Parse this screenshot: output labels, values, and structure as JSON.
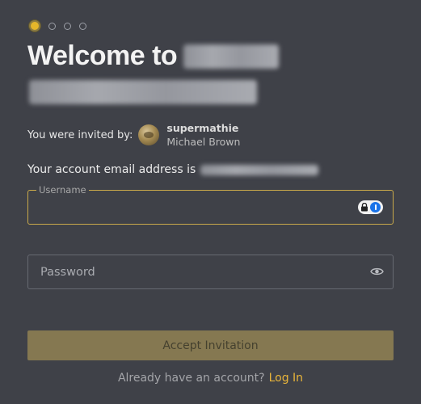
{
  "steps": {
    "total": 4,
    "current": 1
  },
  "header": {
    "welcome_text": "Welcome to"
  },
  "invite": {
    "label": "You were invited by:",
    "inviter_username": "supermathie",
    "inviter_fullname": "Michael Brown"
  },
  "account": {
    "email_label": "Your account email address is"
  },
  "form": {
    "username_label": "Username",
    "username_value": "",
    "password_placeholder": "Password",
    "password_value": ""
  },
  "actions": {
    "accept_label": "Accept Invitation",
    "have_account_text": "Already have an account?",
    "login_link": "Log In"
  },
  "colors": {
    "background": "#3f4148",
    "accent": "#e5b62a",
    "button_bg": "#857851",
    "link": "#e8b43a"
  }
}
